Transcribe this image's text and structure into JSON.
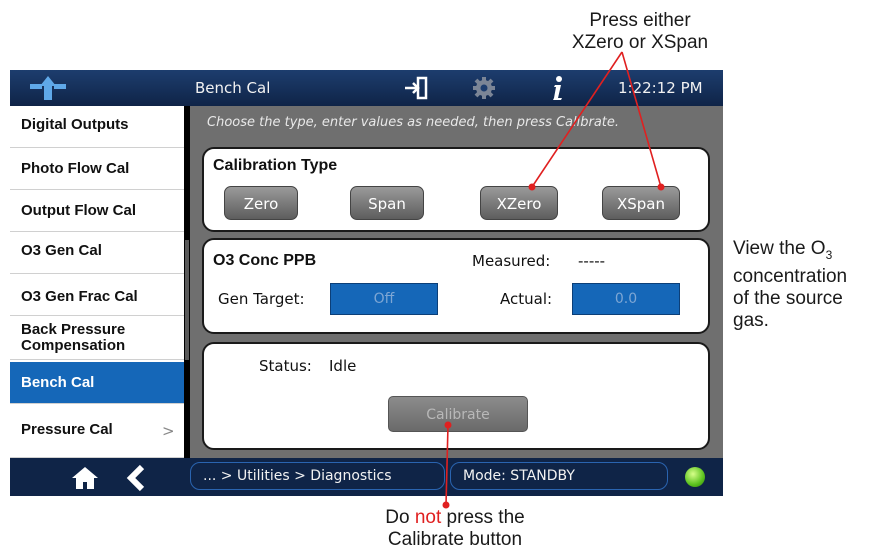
{
  "annotations": {
    "top_line1": "Press either",
    "top_line2": "XZero or XSpan",
    "right_line1_prefix": "View the O",
    "right_sub": "3",
    "right_line2": "concentration",
    "right_line3": "of the source",
    "right_line4": "gas.",
    "bottom_pre": "Do ",
    "bottom_not": "not",
    "bottom_post": " press the",
    "bottom_line2": "Calibrate button",
    "line_color": "#e02020"
  },
  "titlebar": {
    "title": "Bench Cal",
    "time": "1:22:12 PM",
    "icons": [
      "logo-icon",
      "exit-icon",
      "gear-icon",
      "info-icon"
    ]
  },
  "sidebar": {
    "items": [
      {
        "label": "Digital Outputs"
      },
      {
        "label": "Photo Flow Cal"
      },
      {
        "label": "Output Flow Cal"
      },
      {
        "label": "O3 Gen Cal"
      },
      {
        "label": "O3 Gen Frac Cal"
      },
      {
        "label": "Back Pressure",
        "label2": "Compensation"
      },
      {
        "label": "Bench Cal",
        "active": true
      },
      {
        "label": "Pressure Cal",
        "chevron": ">"
      }
    ]
  },
  "main": {
    "hint": "Choose the type, enter values as needed, then press Calibrate.",
    "cal_type": {
      "title": "Calibration Type",
      "buttons": [
        "Zero",
        "Span",
        "XZero",
        "XSpan"
      ]
    },
    "conc": {
      "title": "O3 Conc PPB",
      "measured_label": "Measured:",
      "measured_value": "-----",
      "gen_target_label": "Gen Target:",
      "gen_target_value": "Off",
      "actual_label": "Actual:",
      "actual_value": "0.0"
    },
    "status": {
      "label": "Status:",
      "value": "Idle",
      "calibrate_label": "Calibrate"
    }
  },
  "bottombar": {
    "breadcrumb": "... > Utilities > Diagnostics",
    "mode": "Mode: STANDBY",
    "icons": [
      "home-icon",
      "back-icon",
      "status-led"
    ]
  },
  "colors": {
    "accent_blue": "#1567b8",
    "titlebar": "#0f2447",
    "panel_bg": "#6f6f6f",
    "led_green": "#5bc21e"
  }
}
